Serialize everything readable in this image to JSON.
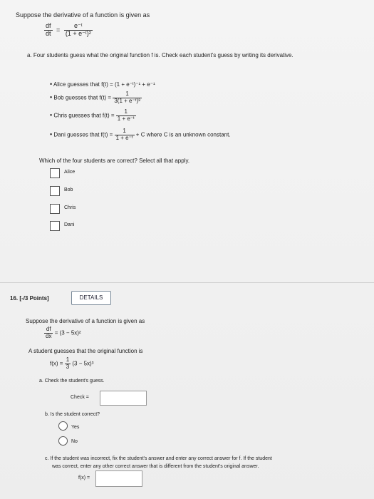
{
  "q15": {
    "intro": "Suppose the derivative of a function is given as",
    "deriv_lhs_num": "df",
    "deriv_lhs_den": "dt",
    "deriv_rhs_num": "e⁻ᵗ",
    "deriv_rhs_den": "(1 + e⁻ᵗ)²",
    "part_a": "a. Four students guess what the original function f is. Check each student's guess by writing its derivative.",
    "alice": "Alice guesses that f(t) = (1 + e⁻ᵗ)⁻¹ + e⁻¹",
    "bob_prefix": "Bob guesses that f(t) =",
    "bob_num": "1",
    "bob_den": "3(1 + e⁻ᵗ)³",
    "chris_prefix": "Chris guesses that f(t) =",
    "chris_num": "1",
    "chris_den": "1 + e⁻ᵗ",
    "dani_prefix": "Dani guesses that f(t) =",
    "dani_num": "1",
    "dani_den": "1 + e⁻ᵗ",
    "dani_suffix": "+ C where C is an unknown constant.",
    "select_prompt": "Which of the four students are correct? Select all that apply.",
    "options": [
      "Alice",
      "Bob",
      "Chris",
      "Dani"
    ]
  },
  "q16": {
    "number": "16.",
    "points": "[-/3 Points]",
    "details_label": "DETAILS",
    "intro": "Suppose the derivative of a function is given as",
    "deriv_num": "df",
    "deriv_den": "dx",
    "deriv_rhs": "= (3 − 5x)²",
    "guess_text": "A student guesses that the original function is",
    "guess_lhs": "f(x) =",
    "guess_num": "1",
    "guess_den": "3",
    "guess_rhs": "(3 − 5x)³",
    "part_a": "a. Check the student's guess.",
    "check_label": "Check =",
    "part_b": "b. Is the student correct?",
    "radio_yes": "Yes",
    "radio_no": "No",
    "part_c_line1": "c. If the student was incorrect, fix the student's answer and enter any correct answer for f. If the student",
    "part_c_line2": "was correct, enter any other correct answer that is different from the student's original answer.",
    "fx_label": "f(x) ="
  }
}
